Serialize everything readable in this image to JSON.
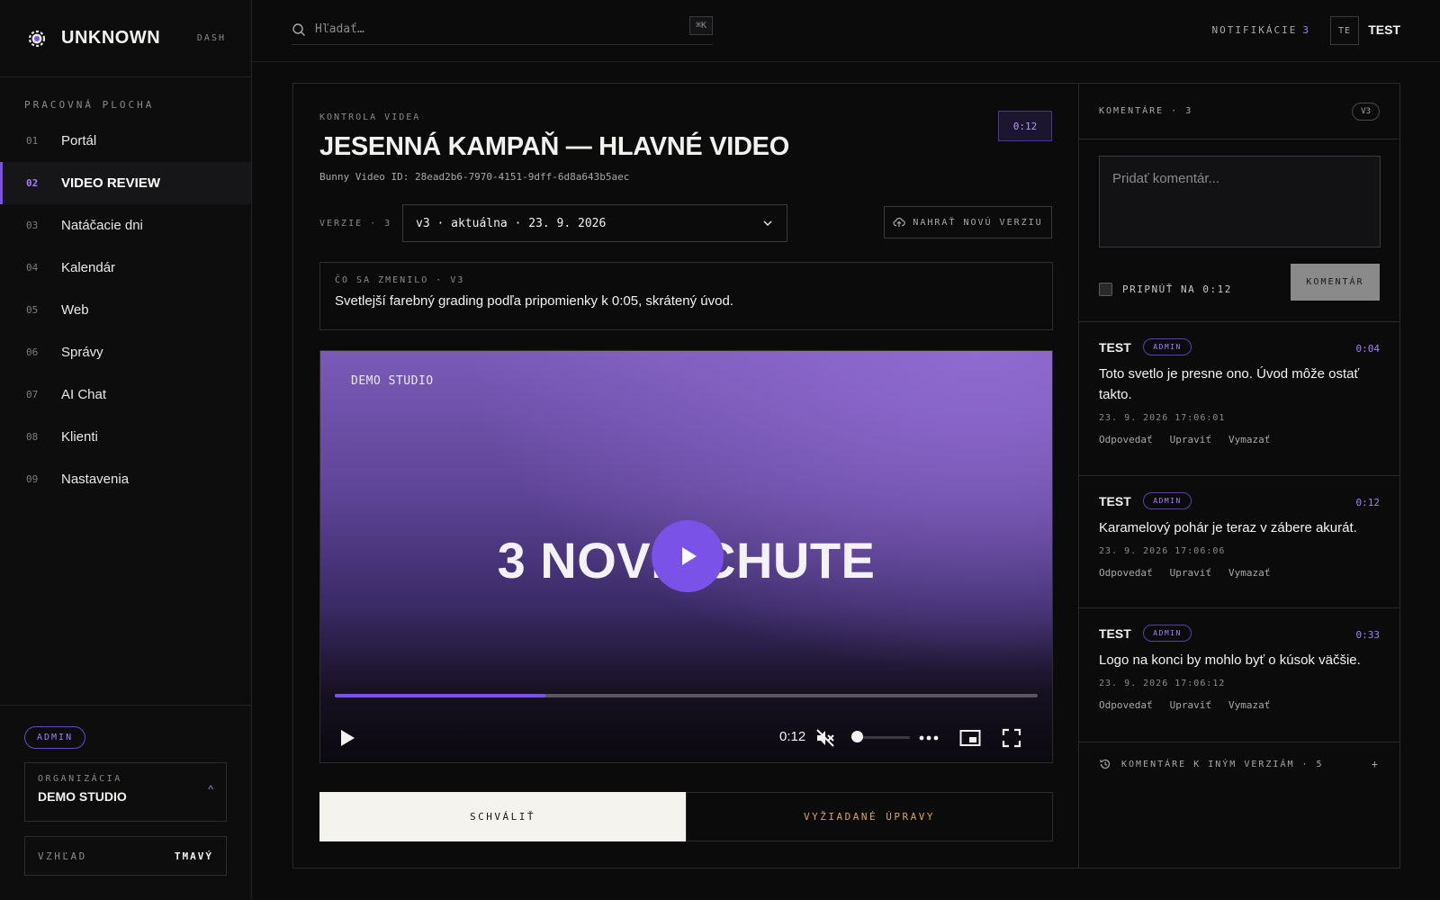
{
  "brand": {
    "name": "UNKNOWN",
    "section": "DASH"
  },
  "sidebar": {
    "section_label": "PRACOVNÁ PLOCHA",
    "items": [
      {
        "num": "01",
        "label": "Portál",
        "icon": "none"
      },
      {
        "num": "02",
        "label": "VIDEO REVIEW",
        "active": true
      },
      {
        "num": "03",
        "label": "Natáčacie dni"
      },
      {
        "num": "04",
        "label": "Kalendár"
      },
      {
        "num": "05",
        "label": "Web"
      },
      {
        "num": "06",
        "label": "Správy"
      },
      {
        "num": "07",
        "label": "AI Chat"
      },
      {
        "num": "08",
        "label": "Klienti"
      },
      {
        "num": "09",
        "label": "Nastavenia"
      }
    ],
    "role_badge": "ADMIN",
    "org_label": "ORGANIZÁCIA",
    "org_value": "DEMO STUDIO",
    "org_caret": "^",
    "theme_label": "VZHĽAD",
    "theme_value": "TMAVÝ"
  },
  "topbar": {
    "search_placeholder": "Hľadať…",
    "search_shortcut": "⌘K",
    "notifications_label": "NOTIFIKÁCIE",
    "notifications_count": "3",
    "avatar_initials": "TE",
    "username": "TEST"
  },
  "review": {
    "kicker": "KONTROLA VIDEA",
    "title": "JESENNÁ KAMPAŇ — HLAVNÉ VIDEO",
    "video_id": "Bunny Video ID: 28ead2b6-7970-4151-9dff-6d8a643b5aec",
    "time_chip": "0:12",
    "versions_label": "VERZIE · 3",
    "version_selected": "v3 · aktuálna · 23. 9. 2026",
    "upload_label": "NAHRAŤ NOVÚ VERZIU",
    "changes_label": "ČO SA ZMENILO · V3",
    "changes_text": "Svetlejší farebný grading podľa pripomienky k 0:05, skrátený úvod.",
    "approve_label": "SCHVÁLIŤ",
    "request_changes_label": "VYŽIADANÉ ÚPRAVY"
  },
  "player": {
    "studio_tag": "DEMO STUDIO",
    "overlay_text": "3 NOVÉ CHUTE",
    "current_time": "0:12",
    "progress": 0.3,
    "volume": 0.0,
    "muted": true,
    "accent": "#7a52e8"
  },
  "comments": {
    "header": "KOMENTÁRE · 3",
    "version_badge": "V3",
    "compose_placeholder": "Pridať komentár...",
    "pin_label": "PRIPNÚŤ NA 0:12",
    "submit_label": "KOMENTÁR",
    "items": [
      {
        "author": "TEST",
        "role": "ADMIN",
        "time": "0:04",
        "body": "Toto svetlo je presne ono. Úvod môže ostať takto.",
        "date": "23. 9. 2026 17:06:01",
        "reply": "Odpovedať",
        "edit": "Upraviť",
        "delete": "Vymazať"
      },
      {
        "author": "TEST",
        "role": "ADMIN",
        "time": "0:12",
        "body": "Karamelový pohár je teraz v zábere akurát.",
        "date": "23. 9. 2026 17:06:06",
        "reply": "Odpovedať",
        "edit": "Upraviť",
        "delete": "Vymazať"
      },
      {
        "author": "TEST",
        "role": "ADMIN",
        "time": "0:33",
        "body": "Logo na konci by mohlo byť o kúsok väčšie.",
        "date": "23. 9. 2026 17:06:12",
        "reply": "Odpovedať",
        "edit": "Upraviť",
        "delete": "Vymazať"
      }
    ],
    "other_versions_label": "KOMENTÁRE K INÝM VERZIÁM · 5",
    "other_versions_toggle": "+"
  }
}
